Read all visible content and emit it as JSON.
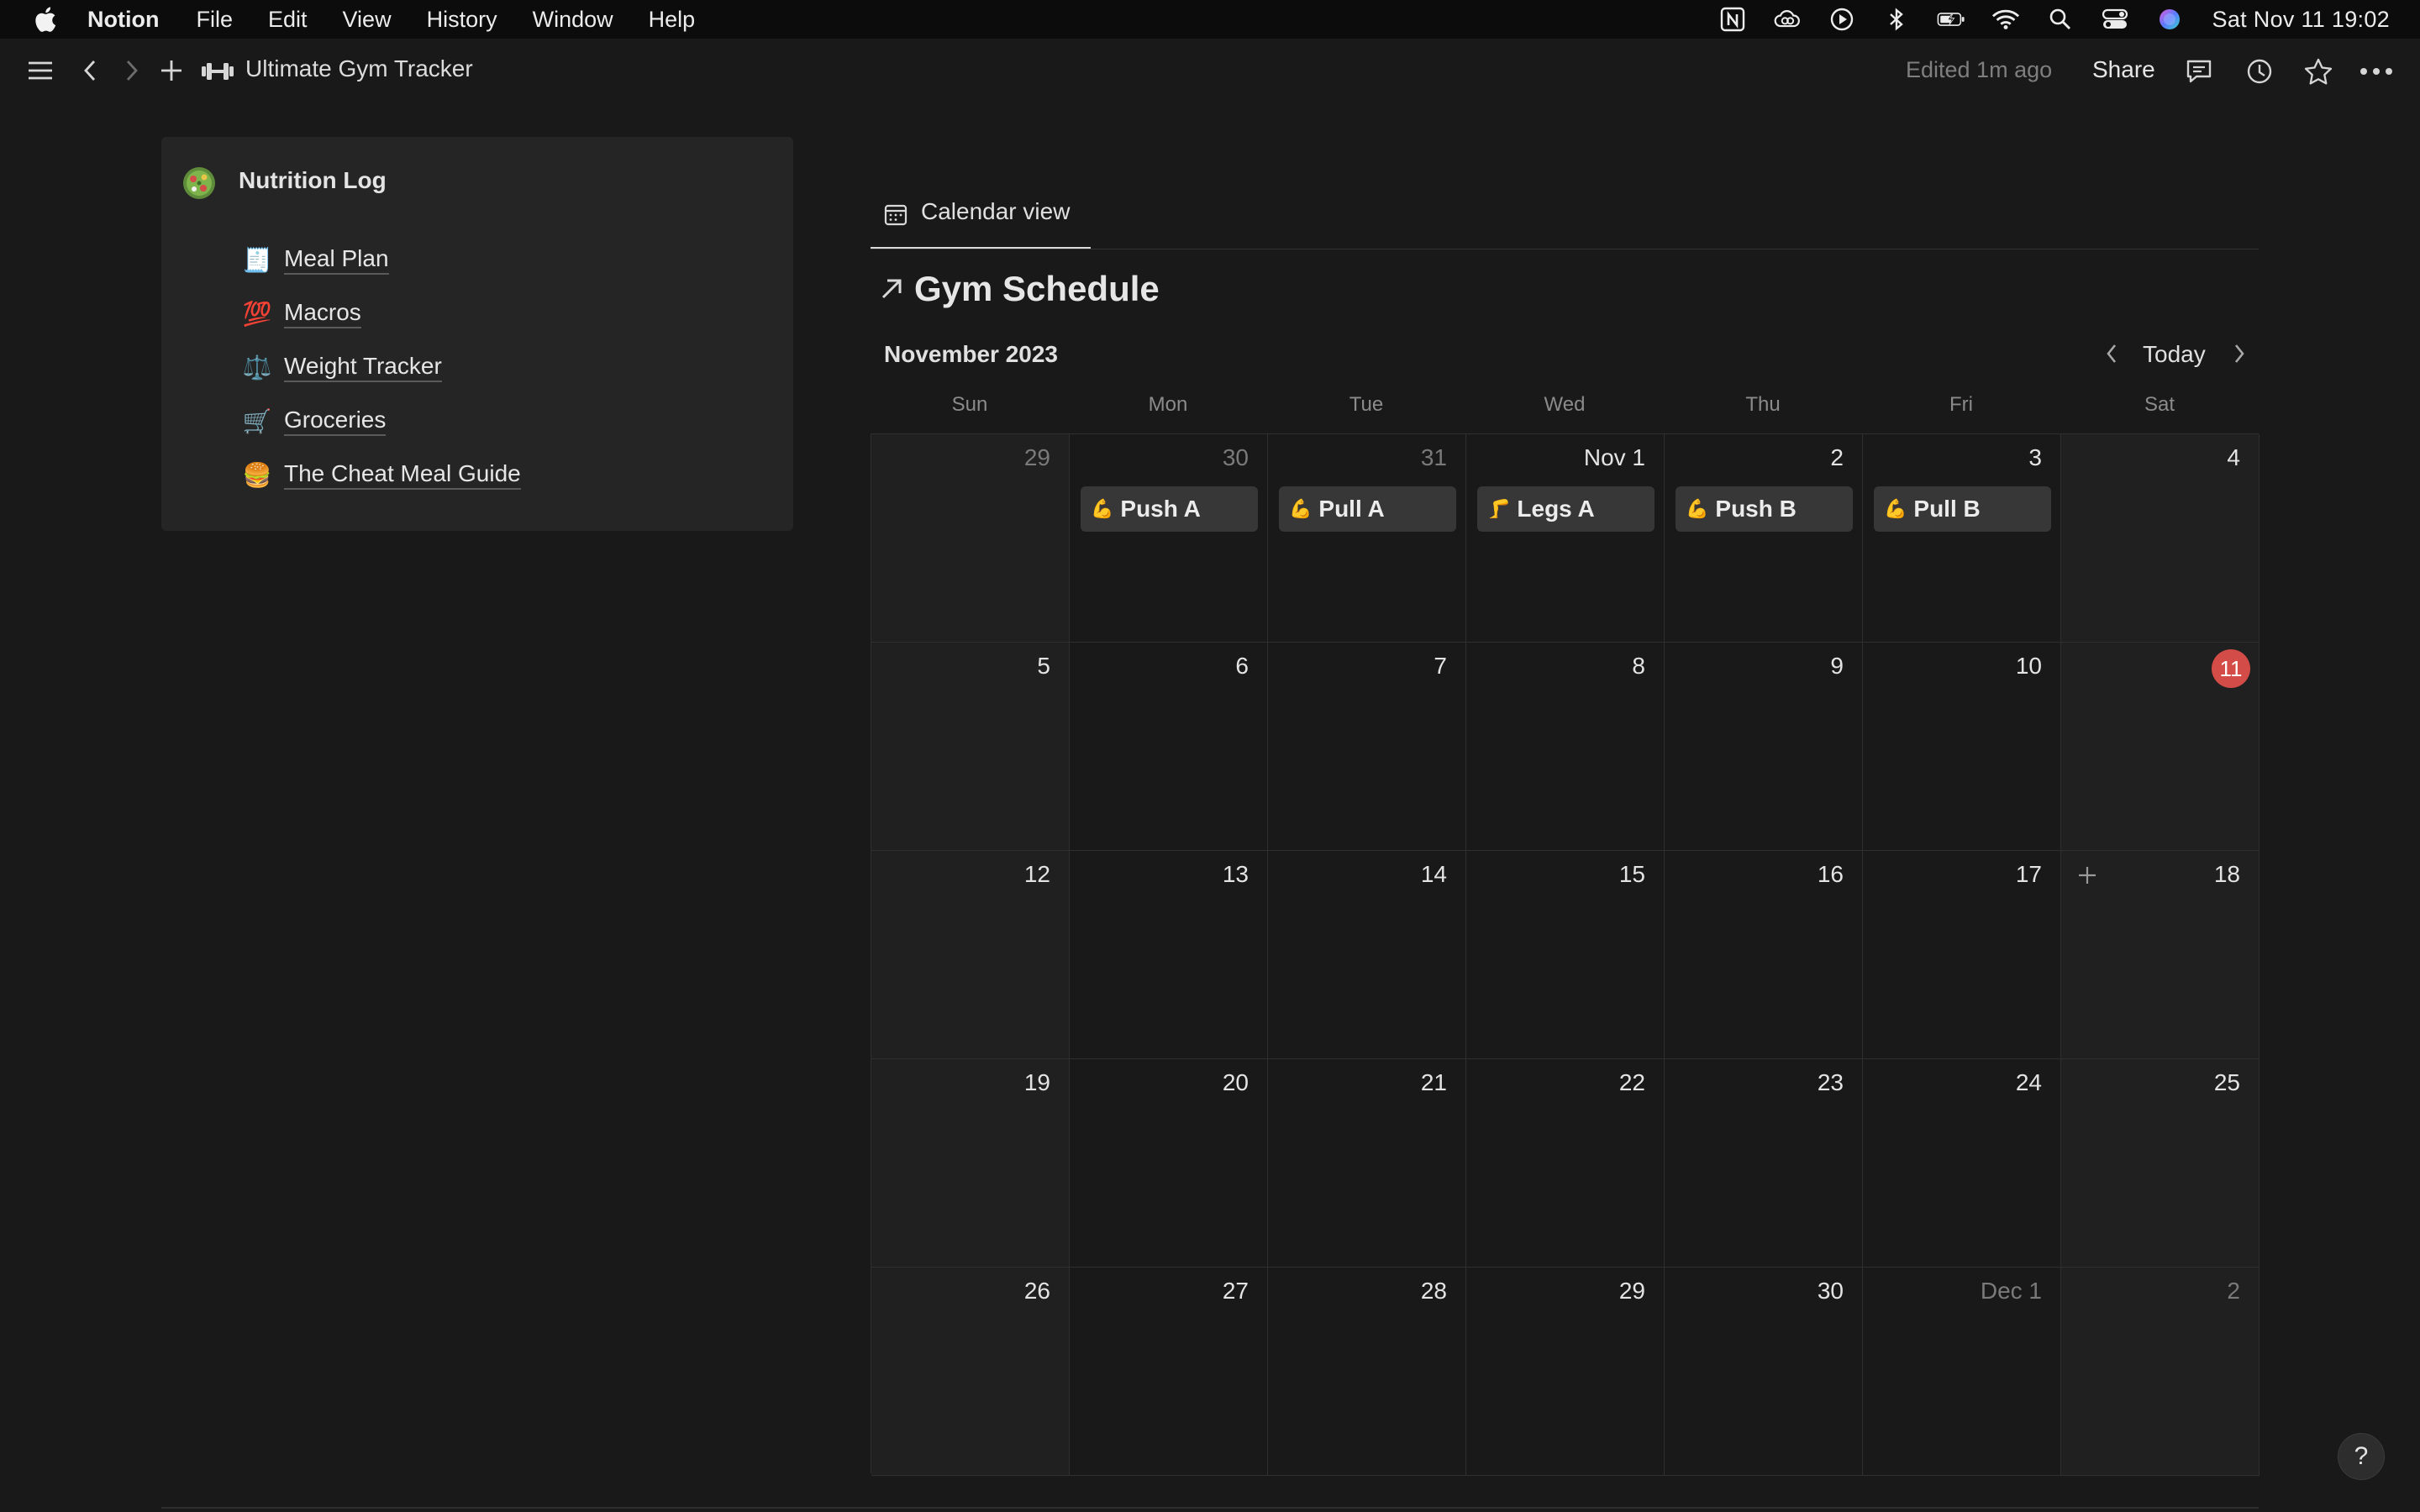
{
  "menubar": {
    "app_name": "Notion",
    "items": [
      "File",
      "Edit",
      "View",
      "History",
      "Window",
      "Help"
    ],
    "status_icons": [
      "notion-icon",
      "creative-cloud-icon",
      "play-circle-icon",
      "bluetooth-icon",
      "battery-icon",
      "wifi-icon",
      "spotlight-search-icon",
      "control-center-icon",
      "siri-icon"
    ],
    "clock": "Sat Nov 11  19:02"
  },
  "topbar": {
    "page_title": "Ultimate Gym Tracker",
    "page_icon": "dumbbell-icon",
    "edited": "Edited 1m ago",
    "share": "Share"
  },
  "nutrition": {
    "title": "Nutrition Log",
    "links": [
      {
        "emoji": "🧾",
        "label": "Meal Plan"
      },
      {
        "emoji": "💯",
        "label": "Macros"
      },
      {
        "emoji": "⚖️",
        "label": "Weight Tracker"
      },
      {
        "emoji": "🛒",
        "label": "Groceries"
      },
      {
        "emoji": "🍔",
        "label": "The Cheat Meal Guide"
      }
    ]
  },
  "calendar": {
    "view_tab": "Calendar view",
    "title": "Gym Schedule",
    "month": "November 2023",
    "today_label": "Today",
    "weekdays": [
      "Sun",
      "Mon",
      "Tue",
      "Wed",
      "Thu",
      "Fri",
      "Sat"
    ],
    "weeks": [
      [
        "29",
        "30",
        "31",
        "Nov 1",
        "2",
        "3",
        "4"
      ],
      [
        "5",
        "6",
        "7",
        "8",
        "9",
        "10",
        "11"
      ],
      [
        "12",
        "13",
        "14",
        "15",
        "16",
        "17",
        "18"
      ],
      [
        "19",
        "20",
        "21",
        "22",
        "23",
        "24",
        "25"
      ],
      [
        "26",
        "27",
        "28",
        "29",
        "30",
        "Dec 1",
        "2"
      ]
    ],
    "dim_days": [
      [
        0,
        0
      ],
      [
        0,
        1
      ],
      [
        0,
        2
      ],
      [
        4,
        5
      ],
      [
        4,
        6
      ]
    ],
    "today_cell": [
      1,
      6
    ],
    "add_cell": [
      2,
      6
    ],
    "events": [
      {
        "week": 0,
        "day": 1,
        "emoji": "💪",
        "label": "Push A"
      },
      {
        "week": 0,
        "day": 2,
        "emoji": "💪",
        "label": "Pull A"
      },
      {
        "week": 0,
        "day": 3,
        "emoji": "🦵",
        "label": "Legs A"
      },
      {
        "week": 0,
        "day": 4,
        "emoji": "💪",
        "label": "Push B"
      },
      {
        "week": 0,
        "day": 5,
        "emoji": "💪",
        "label": "Pull B"
      }
    ],
    "today_color": "#d44c47"
  },
  "help": "?"
}
